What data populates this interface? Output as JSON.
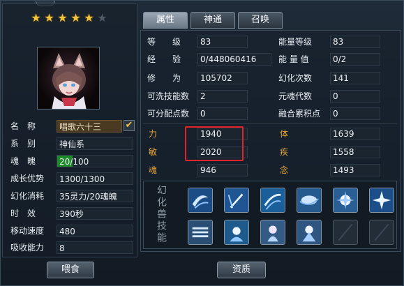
{
  "stars": {
    "filled": 5,
    "total": 6
  },
  "left": {
    "rows": [
      {
        "label": "名　称",
        "value": "唱歌六十三"
      },
      {
        "label": "系　别",
        "value": "神仙系"
      },
      {
        "label": "魂　魄",
        "value": "20/100"
      },
      {
        "label": "成长优势",
        "value": "1300/1300"
      },
      {
        "label": "幻化消耗",
        "value": "35灵力/20魂魄"
      },
      {
        "label": "时　效",
        "value": "390秒"
      },
      {
        "label": "移动速度",
        "value": "480"
      },
      {
        "label": "吸收能力",
        "value": "8"
      }
    ],
    "soul_fraction": 0.2,
    "feed_button": "喂食"
  },
  "tabs": [
    "属性",
    "神通",
    "召唤"
  ],
  "stats": {
    "left": [
      {
        "label": "等　　级",
        "value": "83"
      },
      {
        "label": "经　　验",
        "value": "0/448060416"
      },
      {
        "label": "修　　为",
        "value": "105702"
      },
      {
        "label": "可洗技能数",
        "value": "2"
      },
      {
        "label": "可分配点数",
        "value": "0"
      }
    ],
    "right": [
      {
        "label": "能量等级",
        "value": "83"
      },
      {
        "label": "能 量 值",
        "value": "0/2"
      },
      {
        "label": "幻化次数",
        "value": "141"
      },
      {
        "label": "元魂代数",
        "value": "0"
      },
      {
        "label": "融合累积点",
        "value": "0"
      }
    ],
    "attrs_left": [
      {
        "label": "力",
        "value": "1940"
      },
      {
        "label": "敏",
        "value": "2020"
      },
      {
        "label": "魂",
        "value": "946"
      }
    ],
    "attrs_right": [
      {
        "label": "体",
        "value": "1639"
      },
      {
        "label": "疾",
        "value": "1558"
      },
      {
        "label": "念",
        "value": "1493"
      }
    ]
  },
  "skills": {
    "title": "幻化兽技能",
    "icons": [
      "wind-skill-icon",
      "sword-skill-icon",
      "storm-skill-icon",
      "wave-skill-icon",
      "burst-skill-icon",
      "spark-skill-icon",
      "frost-skill-icon",
      "aura-skill-icon",
      "spirit-skill-icon",
      "ice-skill-icon",
      "empty-slot",
      "empty-slot"
    ]
  },
  "quality_button": "资质",
  "colors": {
    "gold": "#e7a43a",
    "highlight": "#e0242a",
    "soul_bar": "#1f8a2a"
  }
}
